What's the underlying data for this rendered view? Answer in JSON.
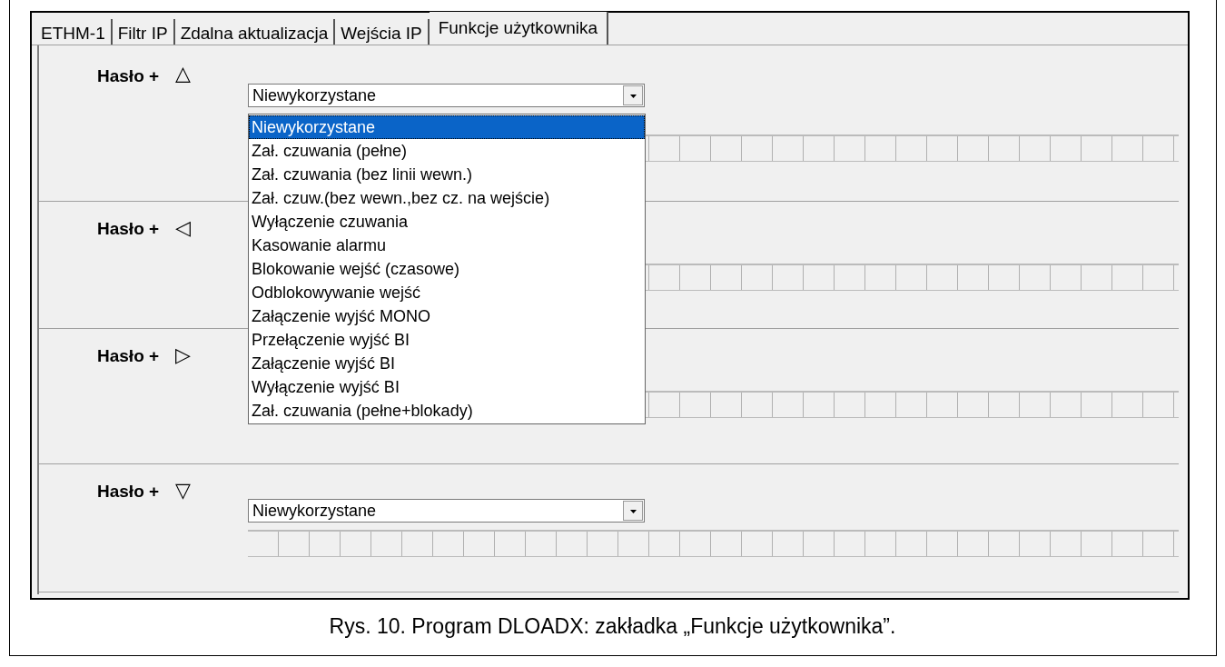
{
  "tabs": [
    {
      "label": "ETHM-1",
      "selected": false
    },
    {
      "label": "Filtr IP",
      "selected": false
    },
    {
      "label": "Zdalna aktualizacja",
      "selected": false
    },
    {
      "label": "Wejścia IP",
      "selected": false
    },
    {
      "label": "Funkcje użytkownika",
      "selected": true
    }
  ],
  "sections": [
    {
      "label": "Hasło +",
      "symbol": "△",
      "value": "Niewykorzystane"
    },
    {
      "label": "Hasło +",
      "symbol": "◁"
    },
    {
      "label": "Hasło +",
      "symbol": "▷"
    },
    {
      "label": "Hasło +",
      "symbol": "▽",
      "value": "Niewykorzystane"
    }
  ],
  "dropdown": {
    "items": [
      {
        "label": "Niewykorzystane",
        "selected": true
      },
      {
        "label": "Zał. czuwania (pełne)",
        "selected": false
      },
      {
        "label": "Zał. czuwania (bez linii wewn.)",
        "selected": false
      },
      {
        "label": "Zał. czuw.(bez wewn.,bez cz. na wejście)",
        "selected": false
      },
      {
        "label": "Wyłączenie czuwania",
        "selected": false
      },
      {
        "label": "Kasowanie alarmu",
        "selected": false
      },
      {
        "label": "Blokowanie wejść (czasowe)",
        "selected": false
      },
      {
        "label": "Odblokowywanie wejść",
        "selected": false
      },
      {
        "label": "Załączenie wyjść MONO",
        "selected": false
      },
      {
        "label": "Przełączenie wyjść BI",
        "selected": false
      },
      {
        "label": "Załączenie wyjść BI",
        "selected": false
      },
      {
        "label": "Wyłączenie wyjść BI",
        "selected": false
      },
      {
        "label": "Zał. czuwania (pełne+blokady)",
        "selected": false
      }
    ]
  },
  "caption": "Rys. 10. Program DLOADX: zakładka „Funkcje użytkownika”."
}
